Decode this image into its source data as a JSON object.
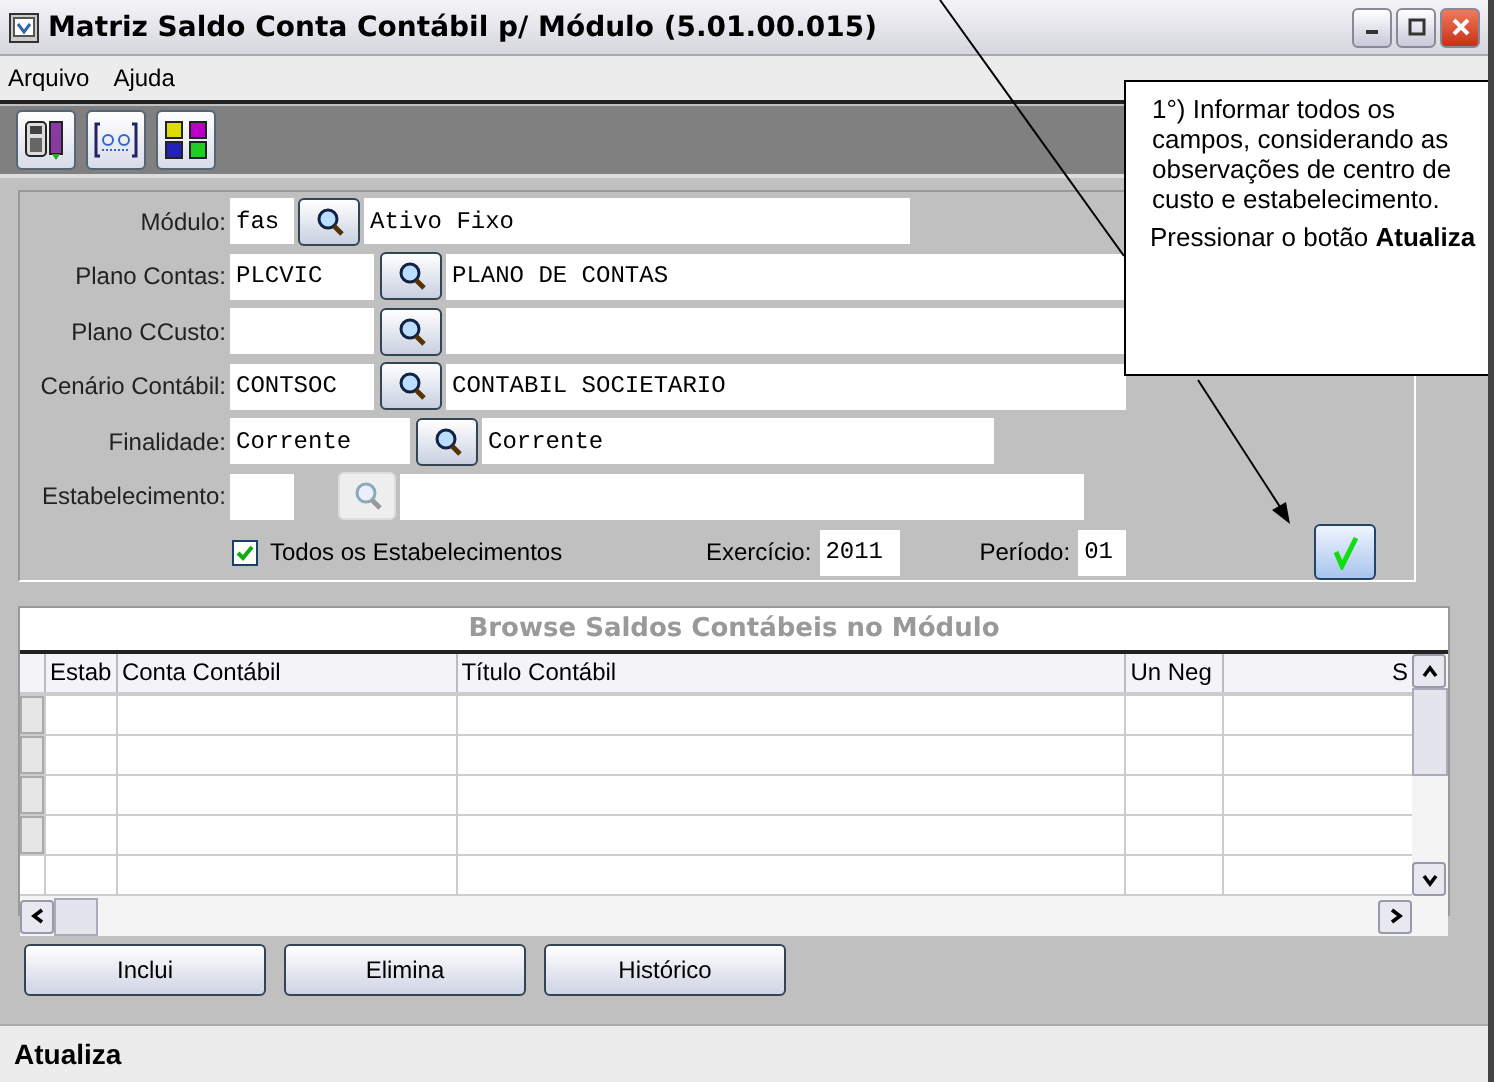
{
  "window": {
    "title": "Matriz Saldo Conta Contábil p/ Módulo (5.01.00.015)"
  },
  "menu": [
    "Arquivo",
    "Ajuda"
  ],
  "form": {
    "fields": [
      {
        "label": "Módulo:",
        "code": "fas",
        "description": "Ativo Fixo",
        "lookup_disabled": false
      },
      {
        "label": "Plano Contas:",
        "code": "PLCVIC",
        "description": "PLANO DE CONTAS",
        "lookup_disabled": false
      },
      {
        "label": "Plano CCusto:",
        "lookup_disabled": false
      },
      {
        "label": "Cenário Contábil:",
        "code": "CONTSOC",
        "description": "CONTABIL SOCIETARIO",
        "lookup_disabled": false
      },
      {
        "label": "Finalidade:",
        "code": "Corrente",
        "description": "Corrente",
        "lookup_disabled": false
      },
      {
        "label": "Estabelecimento:",
        "lookup_disabled": true
      }
    ],
    "all_establishments": {
      "label": "Todos os Estabelecimentos",
      "checked": true
    },
    "exercicio": {
      "label": "Exercício:",
      "value": "2011"
    },
    "periodo": {
      "label": "Período:",
      "value": "01"
    }
  },
  "grid": {
    "title": "Browse Saldos Contábeis no Módulo",
    "columns": [
      "Estab",
      "Conta Contábil",
      "Título Contábil",
      "Un Neg",
      "S"
    ]
  },
  "buttons": [
    "Inclui",
    "Elimina",
    "Histórico"
  ],
  "status_bar": "Atualiza",
  "callout": {
    "text": "1°) Informar  todos os campos, considerando as observações de centro de custo e estabelecimento.",
    "instruction": "Pressionar o botão **Atualiza**"
  }
}
